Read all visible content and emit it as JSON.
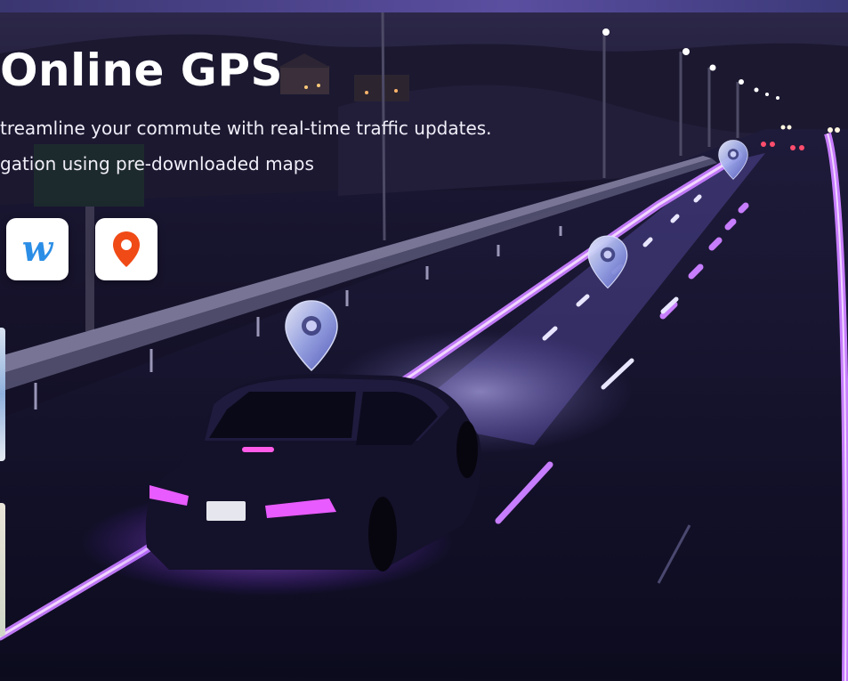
{
  "hero": {
    "title": "Online GPS",
    "line_1": "treamline your commute with real-time traffic updates.",
    "line_2": "gation using pre-downloaded maps"
  },
  "apps": [
    {
      "name": "waze-app",
      "glyph": "w"
    },
    {
      "name": "maps-app",
      "icon": "location-pin-icon"
    }
  ],
  "colors": {
    "accent": "#b45cff",
    "lane_glow": "#c77dff",
    "title": "#ffffff",
    "maps_pin": "#f04a16",
    "waze_blue": "#2b8ee6"
  },
  "icons": [
    "waze-icon",
    "location-pin-icon",
    "map-pin-icon"
  ]
}
